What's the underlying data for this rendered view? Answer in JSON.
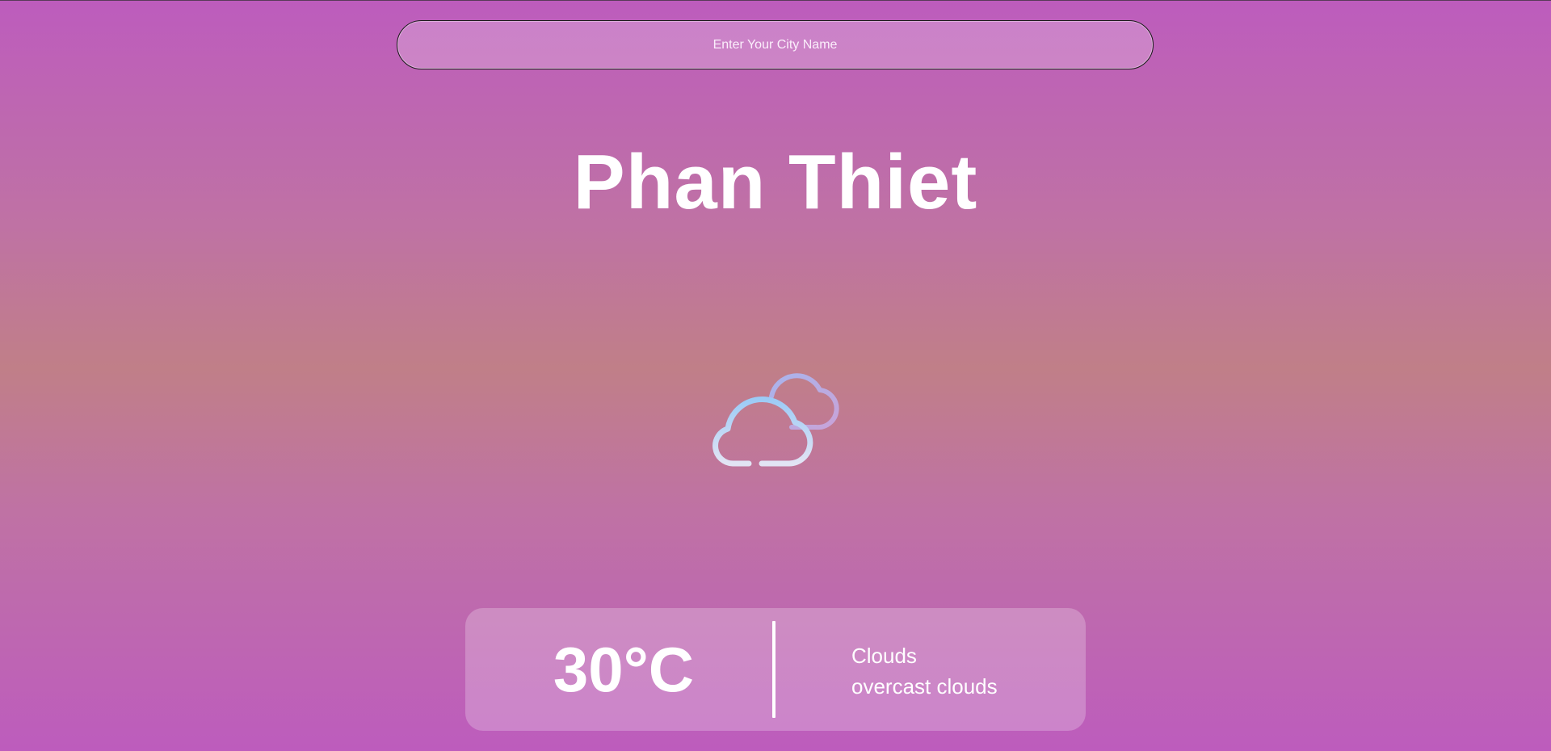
{
  "search": {
    "placeholder": "Enter Your City Name",
    "value": ""
  },
  "city": {
    "name": "Phan Thiet"
  },
  "weather": {
    "icon": "partly-cloudy-icon",
    "temperature": "30°C",
    "main": "Clouds",
    "description": "overcast clouds"
  },
  "colors": {
    "background_top": "#bd5cbd",
    "background_middle": "#c07f88",
    "cloud_front_light": "#dde3f5",
    "cloud_front_dark": "#9fc9f4",
    "cloud_back": "#b9a7dd"
  }
}
